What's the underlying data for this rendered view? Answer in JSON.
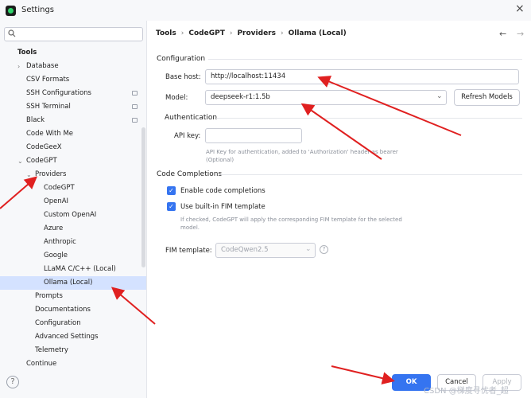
{
  "window": {
    "title": "Settings",
    "close_glyph": "×"
  },
  "search": {
    "placeholder": "Q"
  },
  "sidebar": {
    "items": [
      {
        "label": "Tools",
        "indent": 0,
        "bold": true,
        "chevron": "",
        "gear": false
      },
      {
        "label": "Database",
        "indent": 1,
        "chevron": "›",
        "gear": false
      },
      {
        "label": "CSV Formats",
        "indent": 1,
        "chevron": "",
        "gear": false
      },
      {
        "label": "SSH Configurations",
        "indent": 1,
        "chevron": "",
        "gear": true
      },
      {
        "label": "SSH Terminal",
        "indent": 1,
        "chevron": "",
        "gear": true
      },
      {
        "label": "Black",
        "indent": 1,
        "chevron": "",
        "gear": true
      },
      {
        "label": "Code With Me",
        "indent": 1,
        "chevron": "",
        "gear": false
      },
      {
        "label": "CodeGeeX",
        "indent": 1,
        "chevron": "",
        "gear": false
      },
      {
        "label": "CodeGPT",
        "indent": 1,
        "chevron": "⌄",
        "gear": false
      },
      {
        "label": "Providers",
        "indent": 2,
        "chevron": "⌄",
        "gear": false
      },
      {
        "label": "CodeGPT",
        "indent": 3,
        "chevron": "",
        "gear": false
      },
      {
        "label": "OpenAI",
        "indent": 3,
        "chevron": "",
        "gear": false
      },
      {
        "label": "Custom OpenAI",
        "indent": 3,
        "chevron": "",
        "gear": false
      },
      {
        "label": "Azure",
        "indent": 3,
        "chevron": "",
        "gear": false
      },
      {
        "label": "Anthropic",
        "indent": 3,
        "chevron": "",
        "gear": false
      },
      {
        "label": "Google",
        "indent": 3,
        "chevron": "",
        "gear": false
      },
      {
        "label": "LLaMA C/C++ (Local)",
        "indent": 3,
        "chevron": "",
        "gear": false
      },
      {
        "label": "Ollama (Local)",
        "indent": 3,
        "chevron": "",
        "gear": false,
        "selected": true
      },
      {
        "label": "Prompts",
        "indent": 2,
        "chevron": "",
        "gear": false
      },
      {
        "label": "Documentations",
        "indent": 2,
        "chevron": "",
        "gear": false
      },
      {
        "label": "Configuration",
        "indent": 2,
        "chevron": "",
        "gear": false
      },
      {
        "label": "Advanced Settings",
        "indent": 2,
        "chevron": "",
        "gear": false
      },
      {
        "label": "Telemetry",
        "indent": 2,
        "chevron": "",
        "gear": false
      },
      {
        "label": "Continue",
        "indent": 1,
        "chevron": "",
        "gear": false
      }
    ]
  },
  "breadcrumb": [
    "Tools",
    "CodeGPT",
    "Providers",
    "Ollama (Local)"
  ],
  "breadcrumb_sep": "›",
  "nav": {
    "back": "←",
    "forward": "→"
  },
  "configuration": {
    "title": "Configuration",
    "base_host_label": "Base host:",
    "base_host_value": "http://localhost:11434",
    "model_label": "Model:",
    "model_value": "deepseek-r1:1.5b",
    "refresh_label": "Refresh Models"
  },
  "authentication": {
    "title": "Authentication",
    "api_key_label": "API key:",
    "api_key_value": "",
    "hint_line1": "API Key for authentication, added to 'Authorization' header as bearer",
    "hint_line2": "(Optional)"
  },
  "completions": {
    "title": "Code Completions",
    "enable_label": "Enable code completions",
    "enable_checked": true,
    "fim_label": "Use built-in FIM template",
    "fim_checked": true,
    "fim_hint_line1": "If checked, CodeGPT will apply the corresponding FIM template for the selected",
    "fim_hint_line2": "model.",
    "fim_template_label": "FIM template:",
    "fim_template_value": "CodeQwen2.5",
    "help_glyph": "?"
  },
  "footer": {
    "help_glyph": "?",
    "ok": "OK",
    "cancel": "Cancel",
    "apply": "Apply",
    "watermark": "CSDN @梯度寻优者_超"
  },
  "colors": {
    "accent": "#3574f0",
    "selection": "#d4e2ff",
    "annotation": "#e02020"
  }
}
